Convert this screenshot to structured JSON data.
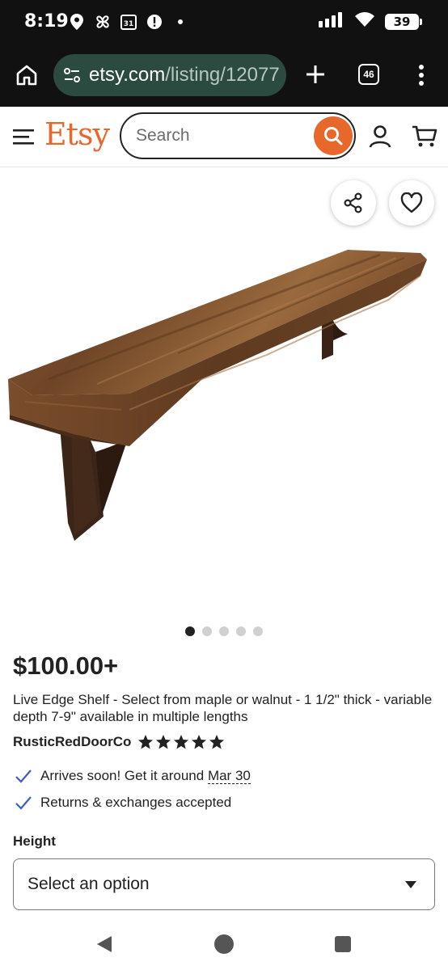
{
  "status_bar": {
    "time": "8:19",
    "calendar_day": "31",
    "battery": "39",
    "icons": [
      "location-icon",
      "pinwheel-icon",
      "calendar-icon",
      "alert-icon",
      "dot-icon",
      "signal-icon",
      "wifi-icon",
      "battery-icon"
    ]
  },
  "browser": {
    "url_domain": "etsy.com",
    "url_path": "/listing/12077",
    "tab_count": "46"
  },
  "header": {
    "logo": "Etsy",
    "search_placeholder": "Search",
    "accent_color": "#e8672b"
  },
  "gallery": {
    "image_count": 5,
    "active_index": 0
  },
  "listing": {
    "price": "$100.00+",
    "title": "Live Edge Shelf - Select from maple or walnut - 1 1/2\" thick - variable depth 7-9\" available in multiple lengths",
    "shop_name": "RusticRedDoorCo",
    "rating_stars": 5,
    "arrival_text": "Arrives soon! Get it around ",
    "arrival_date": "Mar 30",
    "returns_text": "Returns & exchanges accepted"
  },
  "options": {
    "height_label": "Height",
    "height_select": "Select an option"
  }
}
